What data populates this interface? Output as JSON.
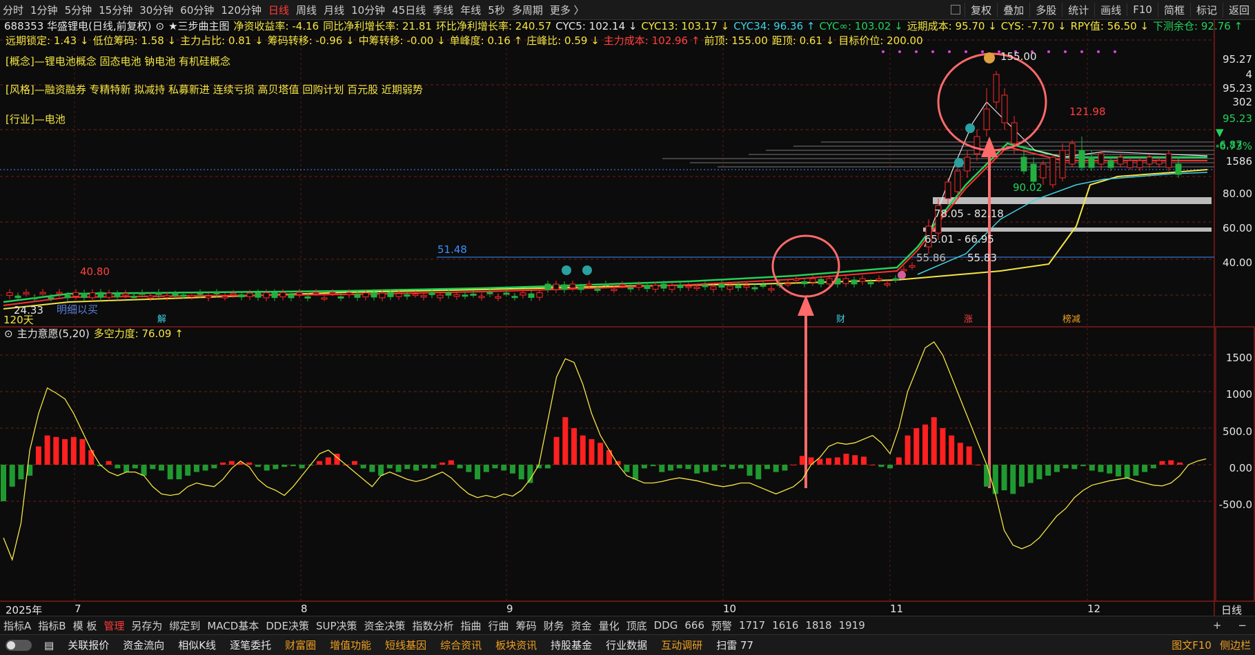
{
  "topbar": {
    "tabs": [
      "分时",
      "1分钟",
      "5分钟",
      "15分钟",
      "30分钟",
      "60分钟",
      "120分钟",
      "日线",
      "周线",
      "月线",
      "10分钟",
      "45日线",
      "季线",
      "年线",
      "5秒",
      "多周期",
      "更多 〉"
    ],
    "active_tab": "日线",
    "right_buttons": [
      "复权",
      "叠加",
      "多股",
      "统计",
      "画线",
      "F10",
      "简框",
      "标记",
      "返回"
    ]
  },
  "main_chart": {
    "stock_title": "688353 华盛锂电(日线,前复权)",
    "template_name": "★三步曲主图",
    "row1": [
      {
        "text": "净资收益率: -4.16",
        "color": "y"
      },
      {
        "text": "同比净利增长率: 21.81",
        "color": "y"
      },
      {
        "text": "环比净利增长率: 240.57",
        "color": "y"
      },
      {
        "text": "CYC5: 102.14 ↓",
        "color": "w"
      },
      {
        "text": "CYC13: 103.17 ↓",
        "color": "y"
      },
      {
        "text": "CYC34: 96.36 ↑",
        "color": "c"
      },
      {
        "text": "CYC∞: 103.02 ↓",
        "color": "g"
      },
      {
        "text": "远期成本: 95.70 ↓",
        "color": "y"
      },
      {
        "text": "CYS: -7.70 ↓",
        "color": "y"
      },
      {
        "text": "RPY值: 56.50 ↓",
        "color": "y"
      },
      {
        "text": "下测余仓: 92.76 ↑",
        "color": "g"
      }
    ],
    "row2": [
      {
        "text": "远期锁定: 1.43 ↓",
        "color": "y"
      },
      {
        "text": "低位筹码: 1.58 ↓",
        "color": "y"
      },
      {
        "text": "主力占比: 0.81 ↓",
        "color": "y"
      },
      {
        "text": "筹码转移: -0.96 ↓",
        "color": "y"
      },
      {
        "text": "中筹转移: -0.00 ↓",
        "color": "y"
      },
      {
        "text": "单峰度: 0.16 ↑",
        "color": "y"
      },
      {
        "text": "庄峰比: 0.59 ↓",
        "color": "y"
      },
      {
        "text": "主力成本: 102.96 ↑",
        "color": "r"
      },
      {
        "text": "前顶: 155.00",
        "color": "y"
      },
      {
        "text": "距顶: 0.61 ↓",
        "color": "y"
      },
      {
        "text": "目标价位: 200.00",
        "color": "y"
      }
    ],
    "concept": "[概念]—锂电池概念 固态电池 钠电池 有机硅概念",
    "style": "[风格]—融资融券 专精特新 拟减持 私募新进 连续亏损 高贝塔值 回购计划 百元股 近期弱势",
    "industry": "[行业]—电池",
    "annotations": {
      "high": "155.00",
      "peak2": "121.98",
      "low_label": "90.02",
      "left_high": "40.80",
      "left_low": "24.33",
      "level_51": "51.48",
      "band1": "78.05 - 82.18",
      "band2": "65.01 - 66.95",
      "band3a": "55.86",
      "band3b": "55.83",
      "days": "120天",
      "faint_text": "明细以买",
      "marks": [
        "解",
        "财",
        "涨",
        "榜减"
      ]
    },
    "price_axis": [
      "95.27",
      "4",
      "95.23",
      "302",
      "95.23",
      "▼ -6.87",
      "-6.73%",
      "1586",
      "80.00",
      "60.00",
      "40.00"
    ]
  },
  "sub_chart": {
    "title": "主力意愿(5,20)",
    "value": "多空力度: 76.09 ↑",
    "axis": [
      "1500",
      "1000",
      "500.0",
      "0.00",
      "-500.0"
    ]
  },
  "x_axis": {
    "labels": [
      "2025年",
      "7",
      "8",
      "9",
      "10",
      "11",
      "12"
    ],
    "period": "日线"
  },
  "bottom_tabs": {
    "tabs": [
      "指标A",
      "指标B",
      "模 板",
      "管理",
      "另存为",
      "绑定到",
      "MACD基本",
      "DDE决策",
      "SUP决策",
      "资金决策",
      "指数分析",
      "指曲",
      "行曲",
      "筹码",
      "财务",
      "资金",
      "量化",
      "顶底",
      "DDG",
      "666",
      "预警",
      "1717",
      "1616",
      "1818",
      "1919"
    ],
    "active": "管理",
    "right": [
      "+",
      "−"
    ]
  },
  "bottom_bar": {
    "items": [
      {
        "text": "关联报价",
        "color": "w"
      },
      {
        "text": "资金流向",
        "color": "w"
      },
      {
        "text": "相似K线",
        "color": "w"
      },
      {
        "text": "逐笔委托",
        "color": "w"
      },
      {
        "text": "财富圈",
        "color": "o"
      },
      {
        "text": "增值功能",
        "color": "o"
      },
      {
        "text": "短线基因",
        "color": "o"
      },
      {
        "text": "综合资讯",
        "color": "o"
      },
      {
        "text": "板块资讯",
        "color": "o"
      },
      {
        "text": "持股基金",
        "color": "w"
      },
      {
        "text": "行业数据",
        "color": "w"
      },
      {
        "text": "互动调研",
        "color": "o"
      },
      {
        "text": "扫雷 77",
        "color": "w"
      }
    ],
    "right": [
      "图文F10",
      "侧边栏"
    ]
  },
  "chart_data": {
    "type": "bar",
    "title": "主力意愿(5,20)",
    "ylim": [
      -1300,
      1800
    ],
    "series": [
      {
        "name": "主力意愿",
        "values": [
          -500,
          -300,
          -200,
          -150,
          250,
          400,
          380,
          350,
          380,
          350,
          200,
          -20,
          50,
          -50,
          -100,
          -50,
          -150,
          -60,
          -80,
          -200,
          -200,
          -150,
          -100,
          -80,
          -50,
          30,
          50,
          30,
          30,
          -30,
          -80,
          -60,
          -30,
          -20,
          -50,
          -10,
          50,
          100,
          150,
          0,
          50,
          -50,
          -100,
          -150,
          -50,
          -100,
          -60,
          -80,
          -50,
          -50,
          30,
          60,
          -50,
          -100,
          -200,
          -100,
          -50,
          -80,
          -120,
          -200,
          -250,
          -50,
          -50,
          380,
          650,
          500,
          400,
          350,
          300,
          200,
          50,
          -100,
          -200,
          -50,
          -20,
          -100,
          -80,
          -50,
          -60,
          -120,
          -100,
          -80,
          -30,
          -60,
          -50,
          -150,
          -200,
          -60,
          -100,
          -80,
          0,
          120,
          100,
          80,
          90,
          100,
          150,
          130,
          110,
          0,
          -30,
          -50,
          100,
          400,
          500,
          550,
          650,
          500,
          400,
          300,
          250,
          0,
          -300,
          -400,
          -350,
          -400,
          -300,
          -250,
          -200,
          -150,
          -100,
          -50,
          -60,
          -20,
          -80,
          -100,
          -120,
          -160,
          -180,
          -150,
          -100,
          -50,
          50,
          60,
          30
        ]
      },
      {
        "name": "多空力度",
        "values": [
          -1000,
          -1300,
          -800,
          200,
          700,
          1050,
          980,
          900,
          700,
          450,
          200,
          0,
          -100,
          -150,
          -100,
          -100,
          -150,
          -300,
          -400,
          -420,
          -400,
          -300,
          -250,
          -280,
          -300,
          -200,
          -50,
          50,
          -30,
          -200,
          -300,
          -350,
          -420,
          -300,
          -150,
          0,
          150,
          200,
          100,
          0,
          -100,
          -200,
          -300,
          -150,
          -100,
          -150,
          -200,
          -230,
          -200,
          -150,
          -100,
          -180,
          -300,
          -400,
          -450,
          -420,
          -450,
          -400,
          -430,
          -350,
          -200,
          0,
          600,
          1200,
          1450,
          1400,
          1100,
          700,
          400,
          200,
          0,
          -150,
          -200,
          -250,
          -250,
          -230,
          -200,
          -180,
          -200,
          -220,
          -250,
          -280,
          -300,
          -280,
          -250,
          -250,
          -300,
          -350,
          -400,
          -350,
          -300,
          -200,
          0,
          100,
          250,
          300,
          280,
          300,
          350,
          400,
          300,
          150,
          500,
          1000,
          1300,
          1600,
          1680,
          1500,
          1200,
          900,
          600,
          300,
          0,
          -400,
          -900,
          -1100,
          -1150,
          -1100,
          -1000,
          -850,
          -700,
          -600,
          -450,
          -350,
          -280,
          -250,
          -220,
          -200,
          -180,
          -220,
          -250,
          -280,
          -290,
          -250,
          -150,
          0,
          50,
          80
        ]
      }
    ]
  }
}
